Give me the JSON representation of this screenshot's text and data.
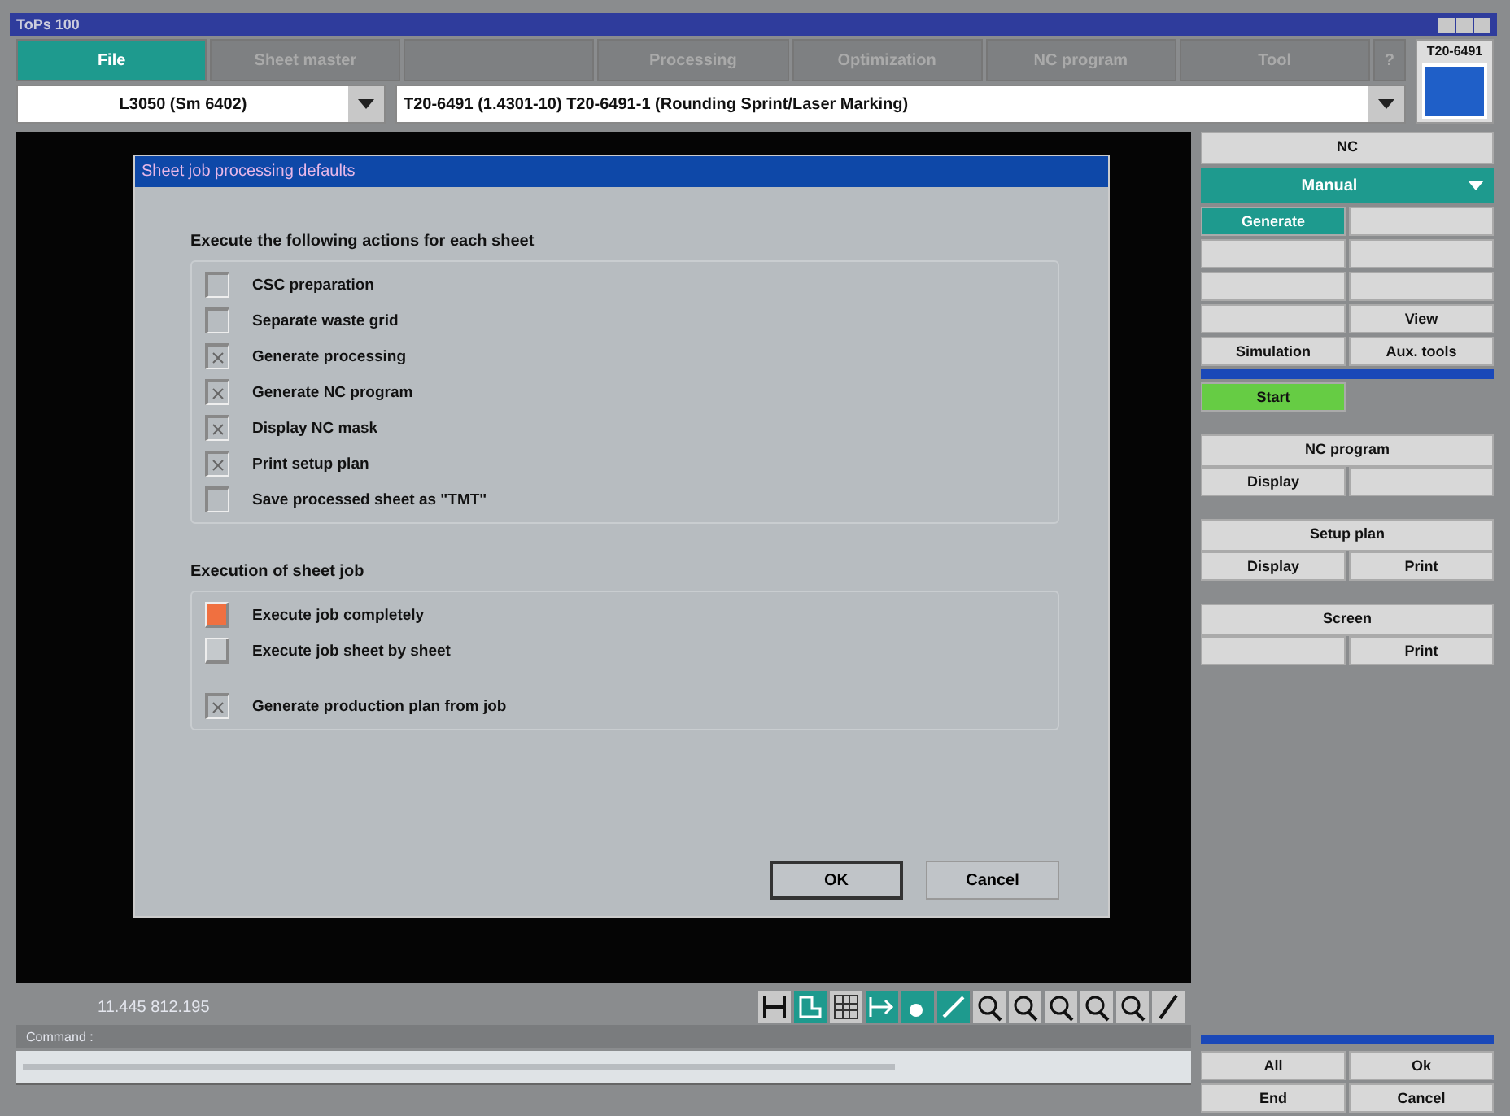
{
  "window": {
    "title": "ToPs 100"
  },
  "tabs": [
    {
      "label": "File",
      "selected": true
    },
    {
      "label": "Sheet master",
      "selected": false
    },
    {
      "selected": false
    },
    {
      "label": "Processing",
      "selected": false
    },
    {
      "label": "Optimization",
      "selected": false
    },
    {
      "label": "NC program",
      "selected": false
    },
    {
      "label": "Tool",
      "selected": false
    },
    {
      "label": "?",
      "selected": false
    }
  ],
  "machine_badge": "T20-6491",
  "machine_select": {
    "value": "L3050 (Sm 6402)"
  },
  "job_select": {
    "value": "T20-6491 (1.4301-10)   T20-6491-1 (Rounding Sprint/Laser Marking)"
  },
  "dialog": {
    "title": "Sheet job processing defaults",
    "actions_heading": "Execute the following actions for each sheet",
    "actions": [
      {
        "label": "CSC preparation",
        "checked": false
      },
      {
        "label": "Separate waste grid",
        "checked": false
      },
      {
        "label": "Generate processing",
        "checked": true
      },
      {
        "label": "Generate NC program",
        "checked": true
      },
      {
        "label": "Display NC mask",
        "checked": true
      },
      {
        "label": "Print setup plan",
        "checked": true
      },
      {
        "label": "Save processed sheet as \"TMT\"",
        "checked": false
      }
    ],
    "execution_heading": "Execution of sheet job",
    "execution_modes": [
      {
        "label": "Execute job completely",
        "selected": true
      },
      {
        "label": "Execute job sheet by sheet",
        "selected": false
      }
    ],
    "production_plan": {
      "label": "Generate production plan from job",
      "checked": true
    },
    "buttons": [
      "OK",
      "Cancel"
    ]
  },
  "side_panel": {
    "nc_header": "NC",
    "mode": "Manual",
    "rows": [
      [
        "Generate",
        null
      ],
      [
        null,
        null
      ],
      [
        null,
        null
      ],
      [
        null,
        "View"
      ],
      [
        "Simulation",
        "Aux. tools"
      ]
    ],
    "start": "Start",
    "groups": [
      {
        "title": "NC program",
        "left_button": "Display"
      },
      {
        "title": "Setup plan",
        "left_button": "Display",
        "right_button": "Print"
      },
      {
        "title": "Screen",
        "right_button": "Print"
      }
    ]
  },
  "status": {
    "coordinates": "11.445   812.195",
    "command_label": "Command :"
  },
  "bottom_buttons": [
    "All",
    "Ok",
    "End",
    "Cancel"
  ]
}
